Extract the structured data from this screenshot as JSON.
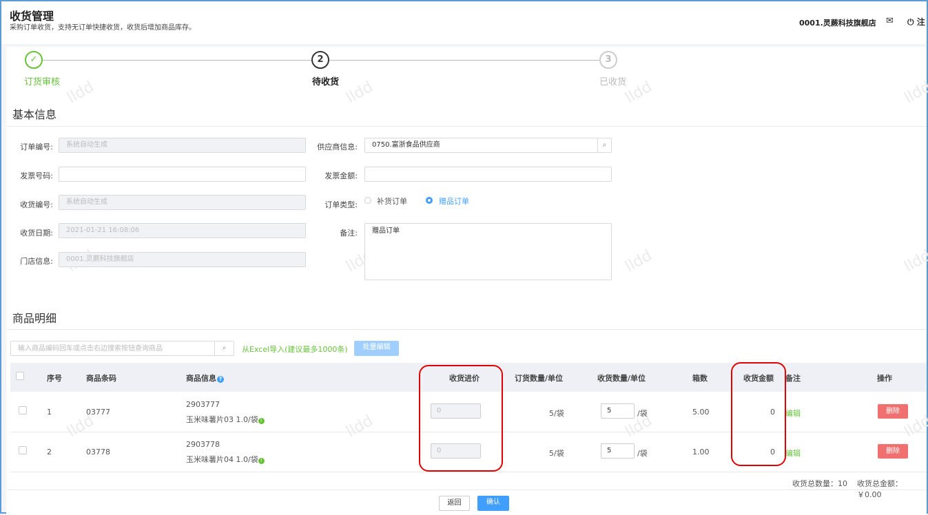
{
  "header": {
    "title": "收货管理",
    "subtitle": "采购订单收货，支持无订单快捷收货，收货后增加商品库存。",
    "store": "0001.灵蕨科技旗舰店",
    "logout_label": "注"
  },
  "steps": [
    {
      "label": "订货审核",
      "num": "✓",
      "state": "done"
    },
    {
      "label": "待收货",
      "num": "2",
      "state": "current"
    },
    {
      "label": "已收货",
      "num": "3",
      "state": "pending"
    }
  ],
  "basic": {
    "title": "基本信息",
    "order_no_label": "订单编号:",
    "order_no": "系统自动生成",
    "invoice_no_label": "发票号码:",
    "invoice_no": "",
    "receipt_no_label": "收货编号:",
    "receipt_no": "系统自动生成",
    "receipt_date_label": "收货日期:",
    "receipt_date": "2021-01-21 16:08:06",
    "store_label": "门店信息:",
    "store": "0001.灵蕨科技旗舰店",
    "supplier_label": "供应商信息:",
    "supplier": "0750.富浙食品供应商",
    "invoice_amount_label": "发票金额:",
    "invoice_amount": "",
    "order_type_label": "订单类型:",
    "order_type_options": [
      "补货订单",
      "赠品订单"
    ],
    "order_type_selected": "赠品订单",
    "remark_label": "备注:",
    "remark": "赠品订单"
  },
  "goods": {
    "title": "商品明细",
    "search_placeholder": "输入商品编码回车或点击右边搜索按钮查询商品",
    "import_link": "从Excel导入(建议最多1000条)",
    "batch_edit": "批量编辑",
    "columns": [
      "序号",
      "商品条码",
      "商品信息",
      "收货进价",
      "订货数量/单位",
      "收货数量/单位",
      "箱数",
      "收货金额",
      "备注",
      "操作"
    ],
    "rows": [
      {
        "no": "1",
        "barcode": "03777",
        "code": "2903777",
        "name": "玉米味薯片03 1.0/袋",
        "price": "0",
        "order_qty": "5/袋",
        "recv_qty": "5",
        "unit": "/袋",
        "boxes": "5.00",
        "amount": "0",
        "edit": "编辑",
        "delete": "删除"
      },
      {
        "no": "2",
        "barcode": "03778",
        "code": "2903778",
        "name": "玉米味薯片04 1.0/袋",
        "price": "0",
        "order_qty": "5/袋",
        "recv_qty": "5",
        "unit": "/袋",
        "boxes": "1.00",
        "amount": "0",
        "edit": "编辑",
        "delete": "删除"
      }
    ],
    "total_qty": "收货总数量：10",
    "total_amount": "收货总金额：￥0.00"
  },
  "footer": {
    "back": "返回",
    "confirm": "确认"
  },
  "watermark": "lldd",
  "colors": {
    "accent": "#409eff",
    "success": "#67c23a",
    "danger": "#f07070"
  }
}
